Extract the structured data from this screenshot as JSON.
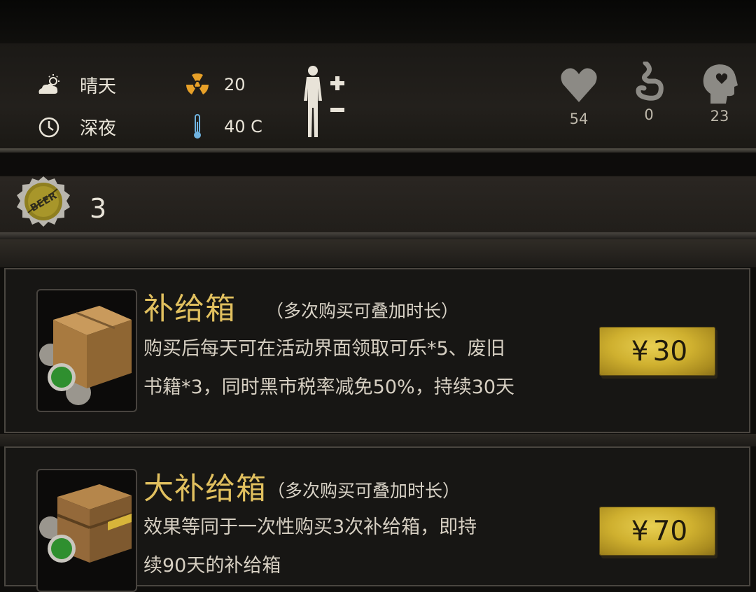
{
  "status": {
    "weather": {
      "icon": "sun-cloud-icon",
      "label": "晴天"
    },
    "time": {
      "icon": "clock-icon",
      "label": "深夜"
    },
    "radiation": {
      "icon": "radiation-icon",
      "value": "20"
    },
    "temperature": {
      "icon": "thermometer-icon",
      "value": "40 C"
    },
    "body_icon": "body-figure-icon",
    "vitals": [
      {
        "icon": "heart-icon",
        "value": "54"
      },
      {
        "icon": "stomach-icon",
        "value": "0"
      },
      {
        "icon": "head-icon",
        "value": "23"
      }
    ]
  },
  "currency": {
    "icon": "beer-cap-icon",
    "cap_text": "BEER",
    "count": "3"
  },
  "shop": {
    "currency_symbol": "¥",
    "items": [
      {
        "icon": "supply-box-icon",
        "title": "补给箱",
        "subtitle": "（多次购买可叠加时长）",
        "desc_line1": "购买后每天可在活动界面领取可乐*5、废旧",
        "desc_line2": "书籍*3，同时黑市税率减免50%，持续30天",
        "price": "30"
      },
      {
        "icon": "large-supply-crate-icon",
        "title": "大补给箱",
        "subtitle": "（多次购买可叠加时长）",
        "desc_line1": "效果等同于一次性购买3次补给箱，即持",
        "desc_line2": "续90天的补给箱",
        "price": "70"
      }
    ]
  },
  "colors": {
    "title_gold": "#e1c05f",
    "price_gold": "#d4b234",
    "panel": "#171614"
  }
}
